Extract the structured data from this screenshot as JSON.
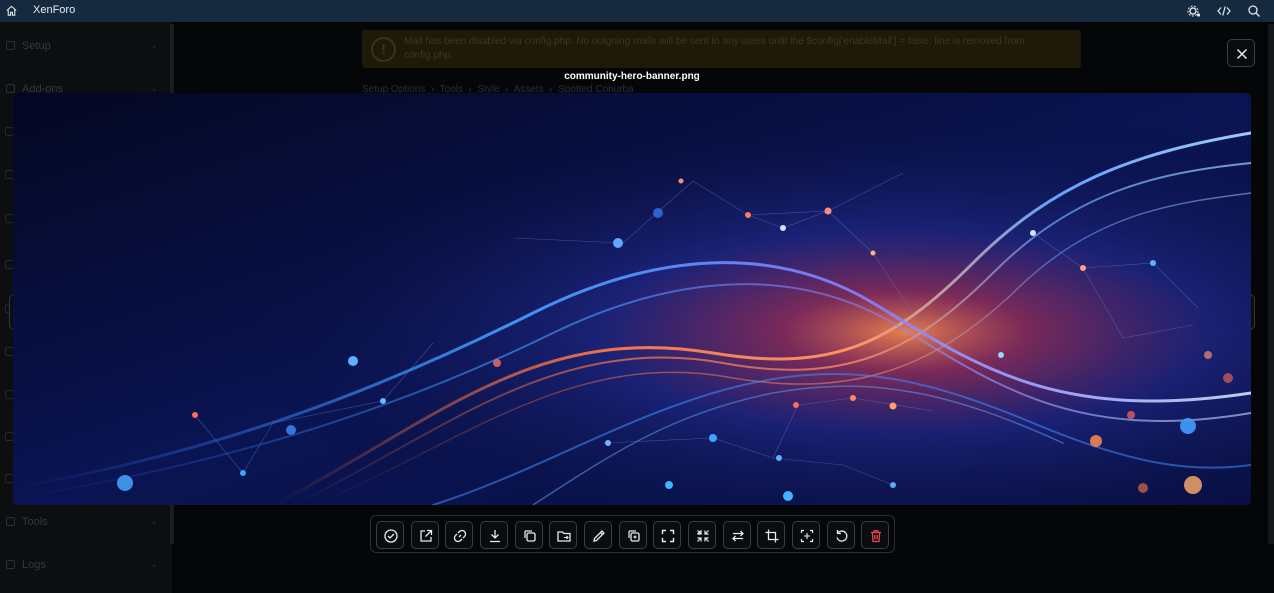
{
  "topbar": {
    "brand": "XenForo"
  },
  "sidebar": {
    "items": [
      {
        "label": "Setup"
      },
      {
        "label": "Add-ons"
      },
      {
        "label": "Tools"
      },
      {
        "label": "Logs"
      }
    ]
  },
  "notice": {
    "text": "Mail has been disabled via config.php. No outgoing mails will be sent to any users until the $config['enableMail'] = false; line is removed from config.php."
  },
  "breadcrumb": [
    "Setup Options",
    "Tools",
    "Style",
    "Assets",
    "Spotted Conurba"
  ],
  "lightbox": {
    "title": "community-hero-banner.png",
    "toolbar": [
      {
        "icon": "check-circle-icon"
      },
      {
        "icon": "external-link-icon"
      },
      {
        "icon": "link-icon"
      },
      {
        "icon": "download-icon"
      },
      {
        "icon": "copy-icon"
      },
      {
        "icon": "folder-move-icon"
      },
      {
        "icon": "pencil-icon"
      },
      {
        "icon": "duplicate-icon"
      },
      {
        "icon": "expand-icon"
      },
      {
        "icon": "collapse-icon"
      },
      {
        "icon": "swap-icon"
      },
      {
        "icon": "crop-icon"
      },
      {
        "icon": "optimize-icon"
      },
      {
        "icon": "rotate-icon"
      },
      {
        "icon": "delete-icon"
      }
    ]
  },
  "colors": {
    "topbar": "#152a3e",
    "backdrop": "#050607",
    "delete": "#e5484d"
  }
}
